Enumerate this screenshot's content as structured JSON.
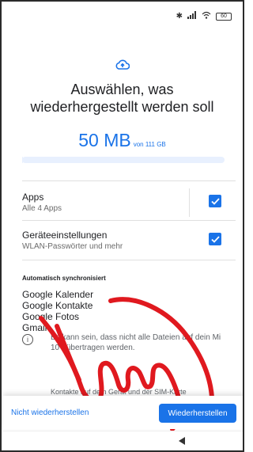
{
  "status": {
    "bluetooth_icon": "bluetooth-icon",
    "signal_icon": "signal-icon",
    "wifi_icon": "wifi-icon",
    "battery_level": "60"
  },
  "header": {
    "icon": "cloud-upload-icon",
    "title_line1": "Auswählen, was",
    "title_line2": "wiederhergestellt werden soll"
  },
  "size": {
    "amount": "50 MB",
    "of_text": "von 111 GB",
    "progress_fraction": 0.0005
  },
  "options": [
    {
      "label": "Apps",
      "sub": "Alle 4 Apps",
      "checked": true
    },
    {
      "label": "Geräteeinstellungen",
      "sub": "WLAN-Passwörter und mehr",
      "checked": true
    }
  ],
  "sync": {
    "label": "Automatisch synchronisiert",
    "items": [
      "Google Kalender",
      "Google Kontakte",
      "Google Fotos",
      "Gmail"
    ]
  },
  "info": {
    "text": "Es kann sein, dass nicht alle Dateien auf dein Mi 10T übertragen werden.",
    "text2": "Kontakte auf dem Gerät und der SIM-Karte"
  },
  "footer": {
    "secondary_label": "Nicht wiederherstellen",
    "primary_label": "Wiederherstellen"
  },
  "colors": {
    "accent": "#1a73e8",
    "overlay_hand": "#e0191f"
  }
}
